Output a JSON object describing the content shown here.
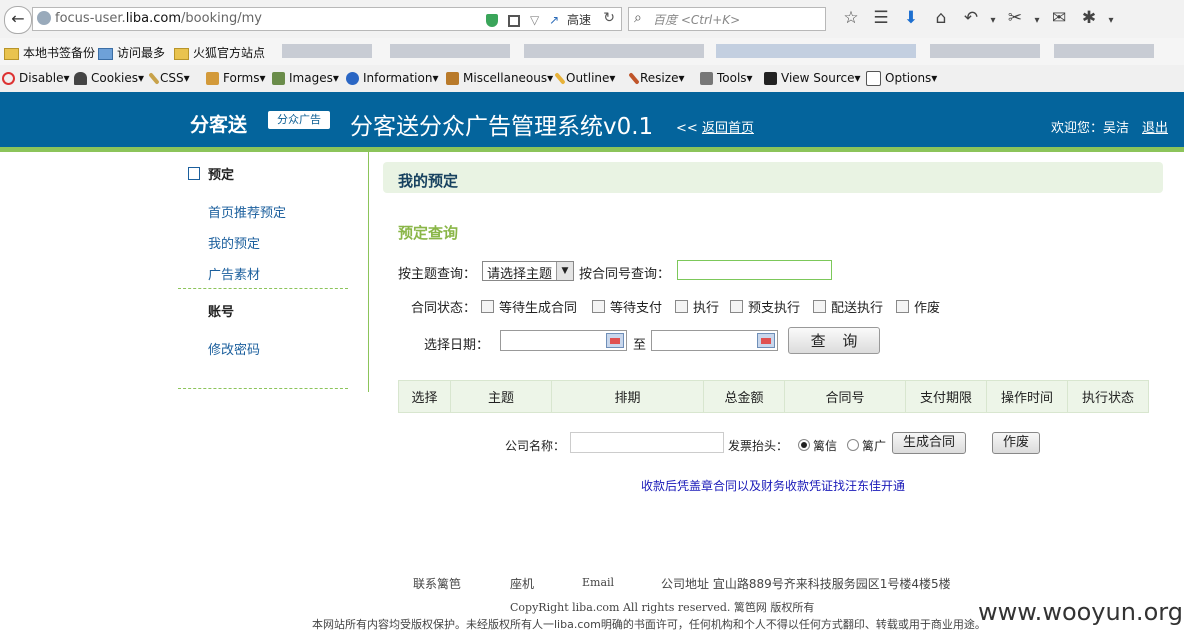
{
  "browser": {
    "url_prefix": "focus-user.",
    "url_host": "liba.com",
    "url_path": "/booking/my",
    "speed_label": "高速",
    "search_placeholder": "百度 <Ctrl+K>",
    "bookmarks": [
      "本地书签备份",
      "访问最多",
      "火狐官方站点"
    ],
    "devbar": [
      "Disable▾",
      "Cookies▾",
      "CSS▾",
      "Forms▾",
      "Images▾",
      "Information▾",
      "Miscellaneous▾",
      "Outline▾",
      "Resize▾",
      "Tools▾",
      "View Source▾",
      "Options▾"
    ]
  },
  "header": {
    "logo": "分客送",
    "logo_tag": "分众广告",
    "system_title": "分客送分众广告管理系统v0.1",
    "back_prefix": "<<",
    "back_link": "返回首页",
    "welcome": "欢迎您：吴洁",
    "logout": "退出"
  },
  "sidebar": {
    "section1": "预定",
    "items": [
      "首页推荐预定",
      "我的预定",
      "广告素材"
    ],
    "section2": "账号",
    "items2": [
      "修改密码"
    ]
  },
  "main": {
    "page_title": "我的预定",
    "query_title": "预定查询",
    "topic_label": "按主题查询：",
    "topic_select": "请选择主题",
    "contract_label": "按合同号查询：",
    "status_label": "合同状态：",
    "statuses": [
      "等待生成合同",
      "等待支付",
      "执行",
      "预支执行",
      "配送执行",
      "作废"
    ],
    "date_label": "选择日期：",
    "date_to": "至",
    "query_button": "查 询",
    "columns": [
      "选择",
      "主题",
      "排期",
      "总金额",
      "合同号",
      "支付期限",
      "操作时间",
      "执行状态"
    ],
    "company_label": "公司名称：",
    "invoice_label": "发票抬头：",
    "invoice_options": [
      "篱信",
      "篱广"
    ],
    "generate_button": "生成合同",
    "void_button": "作废",
    "notice": "收款后凭盖章合同以及财务收款凭证找汪东佳开通"
  },
  "footer": {
    "links": [
      "联系篱笆",
      "座机",
      "Email",
      "公司地址  宜山路889号齐来科技服务园区1号楼4楼5楼"
    ],
    "copyright": "CopyRight  liba.com All rights reserved. 篱笆网 版权所有",
    "legal": "本网站所有内容均受版权保护。未经版权所有人一liba.com明确的书面许可，任何机构和个人不得以任何方式翻印、转载或用于商业用途。",
    "watermark": "www.wooyun.org"
  }
}
